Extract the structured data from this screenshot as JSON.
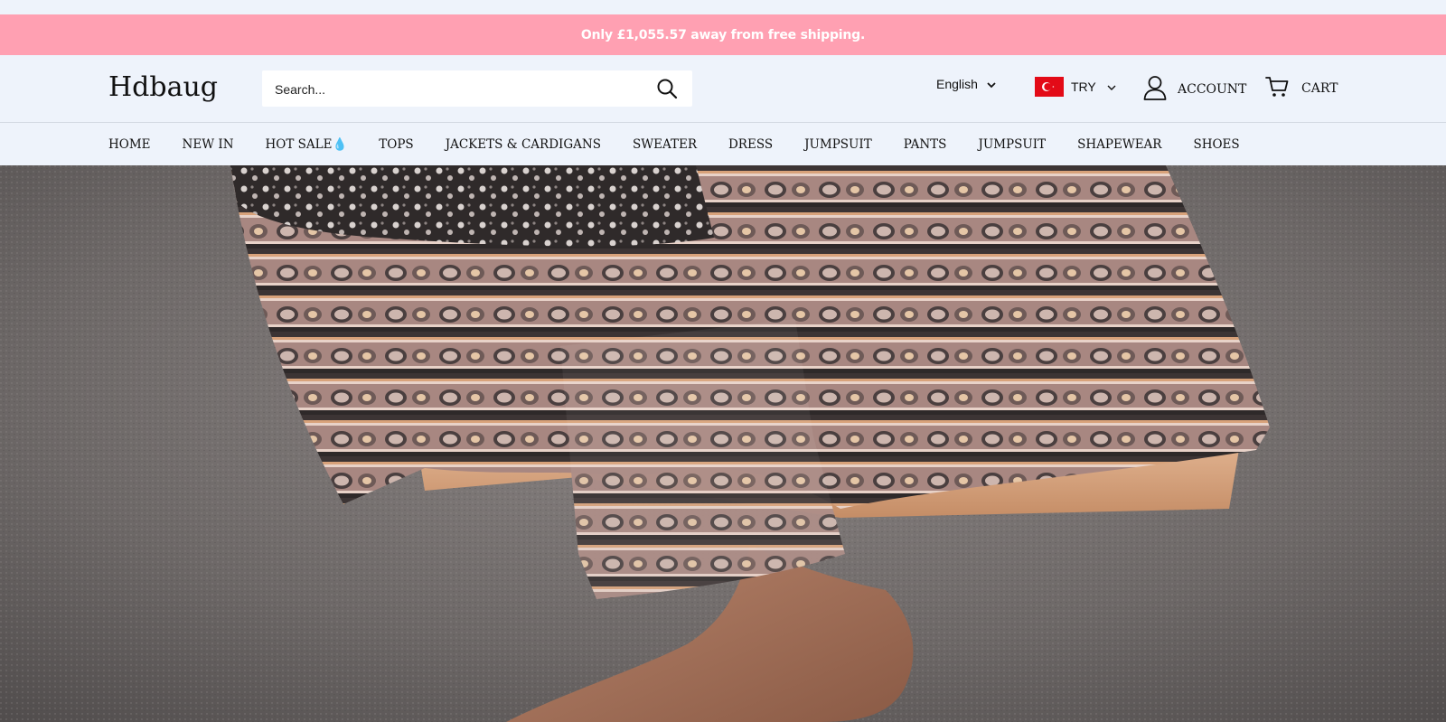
{
  "announcement": {
    "text": "Only £1,055.57 away from free shipping."
  },
  "header": {
    "logo": "Hdbaug",
    "search": {
      "placeholder": "Search...",
      "value": ""
    },
    "language": {
      "selected": "English"
    },
    "currency": {
      "selected": "TRY"
    },
    "account_label": "ACCOUNT",
    "cart_label": "CART"
  },
  "nav": {
    "items": [
      {
        "label": "HOME"
      },
      {
        "label": "NEW IN"
      },
      {
        "label": "HOT SALE💧"
      },
      {
        "label": "TOPS"
      },
      {
        "label": "JACKETS & CARDIGANS"
      },
      {
        "label": "SWEATER"
      },
      {
        "label": "DRESS"
      },
      {
        "label": "JUMPSUIT"
      },
      {
        "label": "PANTS"
      },
      {
        "label": "JUMPSUIT"
      },
      {
        "label": "SHAPEWEAR"
      },
      {
        "label": "SHOES"
      }
    ]
  },
  "colors": {
    "announcement_bg": "#ffa0b2",
    "header_bg": "#eef3fb",
    "flag_red": "#e30a17"
  },
  "icons": {
    "search": "search-icon",
    "chevron": "chevron-down-icon",
    "flag": "turkey-flag-icon",
    "account": "user-icon",
    "cart": "cart-icon"
  }
}
